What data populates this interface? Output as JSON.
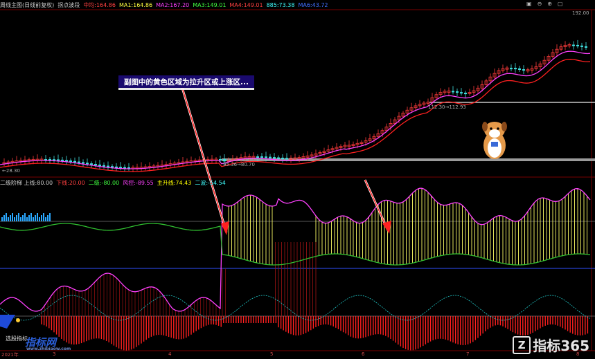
{
  "app": {
    "name": "指标365"
  },
  "top_legend": [
    {
      "text": "周线主图(日线前复权)",
      "color": "#cfcfcf"
    },
    {
      "text": "拐点波段",
      "color": "#cfcfcf"
    },
    {
      "text": "中均:164.86",
      "color": "#ff4040"
    },
    {
      "text": "MA1:164.86",
      "color": "#ffff40"
    },
    {
      "text": "MA2:167.20",
      "color": "#ff40ff"
    },
    {
      "text": "MA3:149.01",
      "color": "#40ff40"
    },
    {
      "text": "MA4:149.01",
      "color": "#ff4040"
    },
    {
      "text": "885:73.38",
      "color": "#40ffff"
    },
    {
      "text": "MA6:43.72",
      "color": "#4070ff"
    }
  ],
  "price_labels": {
    "high": "192.00",
    "mid": "112.30→112.93",
    "low": "95.36→80.70",
    "bottom": "←28.30"
  },
  "sub_legend": [
    {
      "text": "二级阶梯 上线:80.00",
      "color": "#cfcfcf"
    },
    {
      "text": "下线:20.00",
      "color": "#ff4040"
    },
    {
      "text": "二级:-80.00",
      "color": "#40ff40"
    },
    {
      "text": "风控:-89.55",
      "color": "#ff40ff"
    },
    {
      "text": "主升线:74.43",
      "color": "#ffff00"
    },
    {
      "text": "二波:-54.54",
      "color": "#40ffff"
    }
  ],
  "callout": {
    "text": "副图中的黄色区域为拉升区或上涨区..."
  },
  "bottom_left_label": "选股指标",
  "watermark_left": {
    "main": "指标网",
    "sub": "www.zhibiaow.com"
  },
  "watermark_right": {
    "box": "Z",
    "text": "指标365"
  },
  "dates": [
    "2021年",
    "3",
    "4",
    "5",
    "6",
    "7",
    "8"
  ],
  "corner_icons": [
    "▣",
    "⊖",
    "⊕",
    "▢"
  ],
  "colors": {
    "up": "#ff3b3b",
    "down": "#40e0e0",
    "ma_fast": "#ff40ff",
    "ma_slow": "#ff2020",
    "yellow_zone": "#ffff66",
    "red_zone": "#ff2020",
    "green_line": "#30c030"
  }
}
